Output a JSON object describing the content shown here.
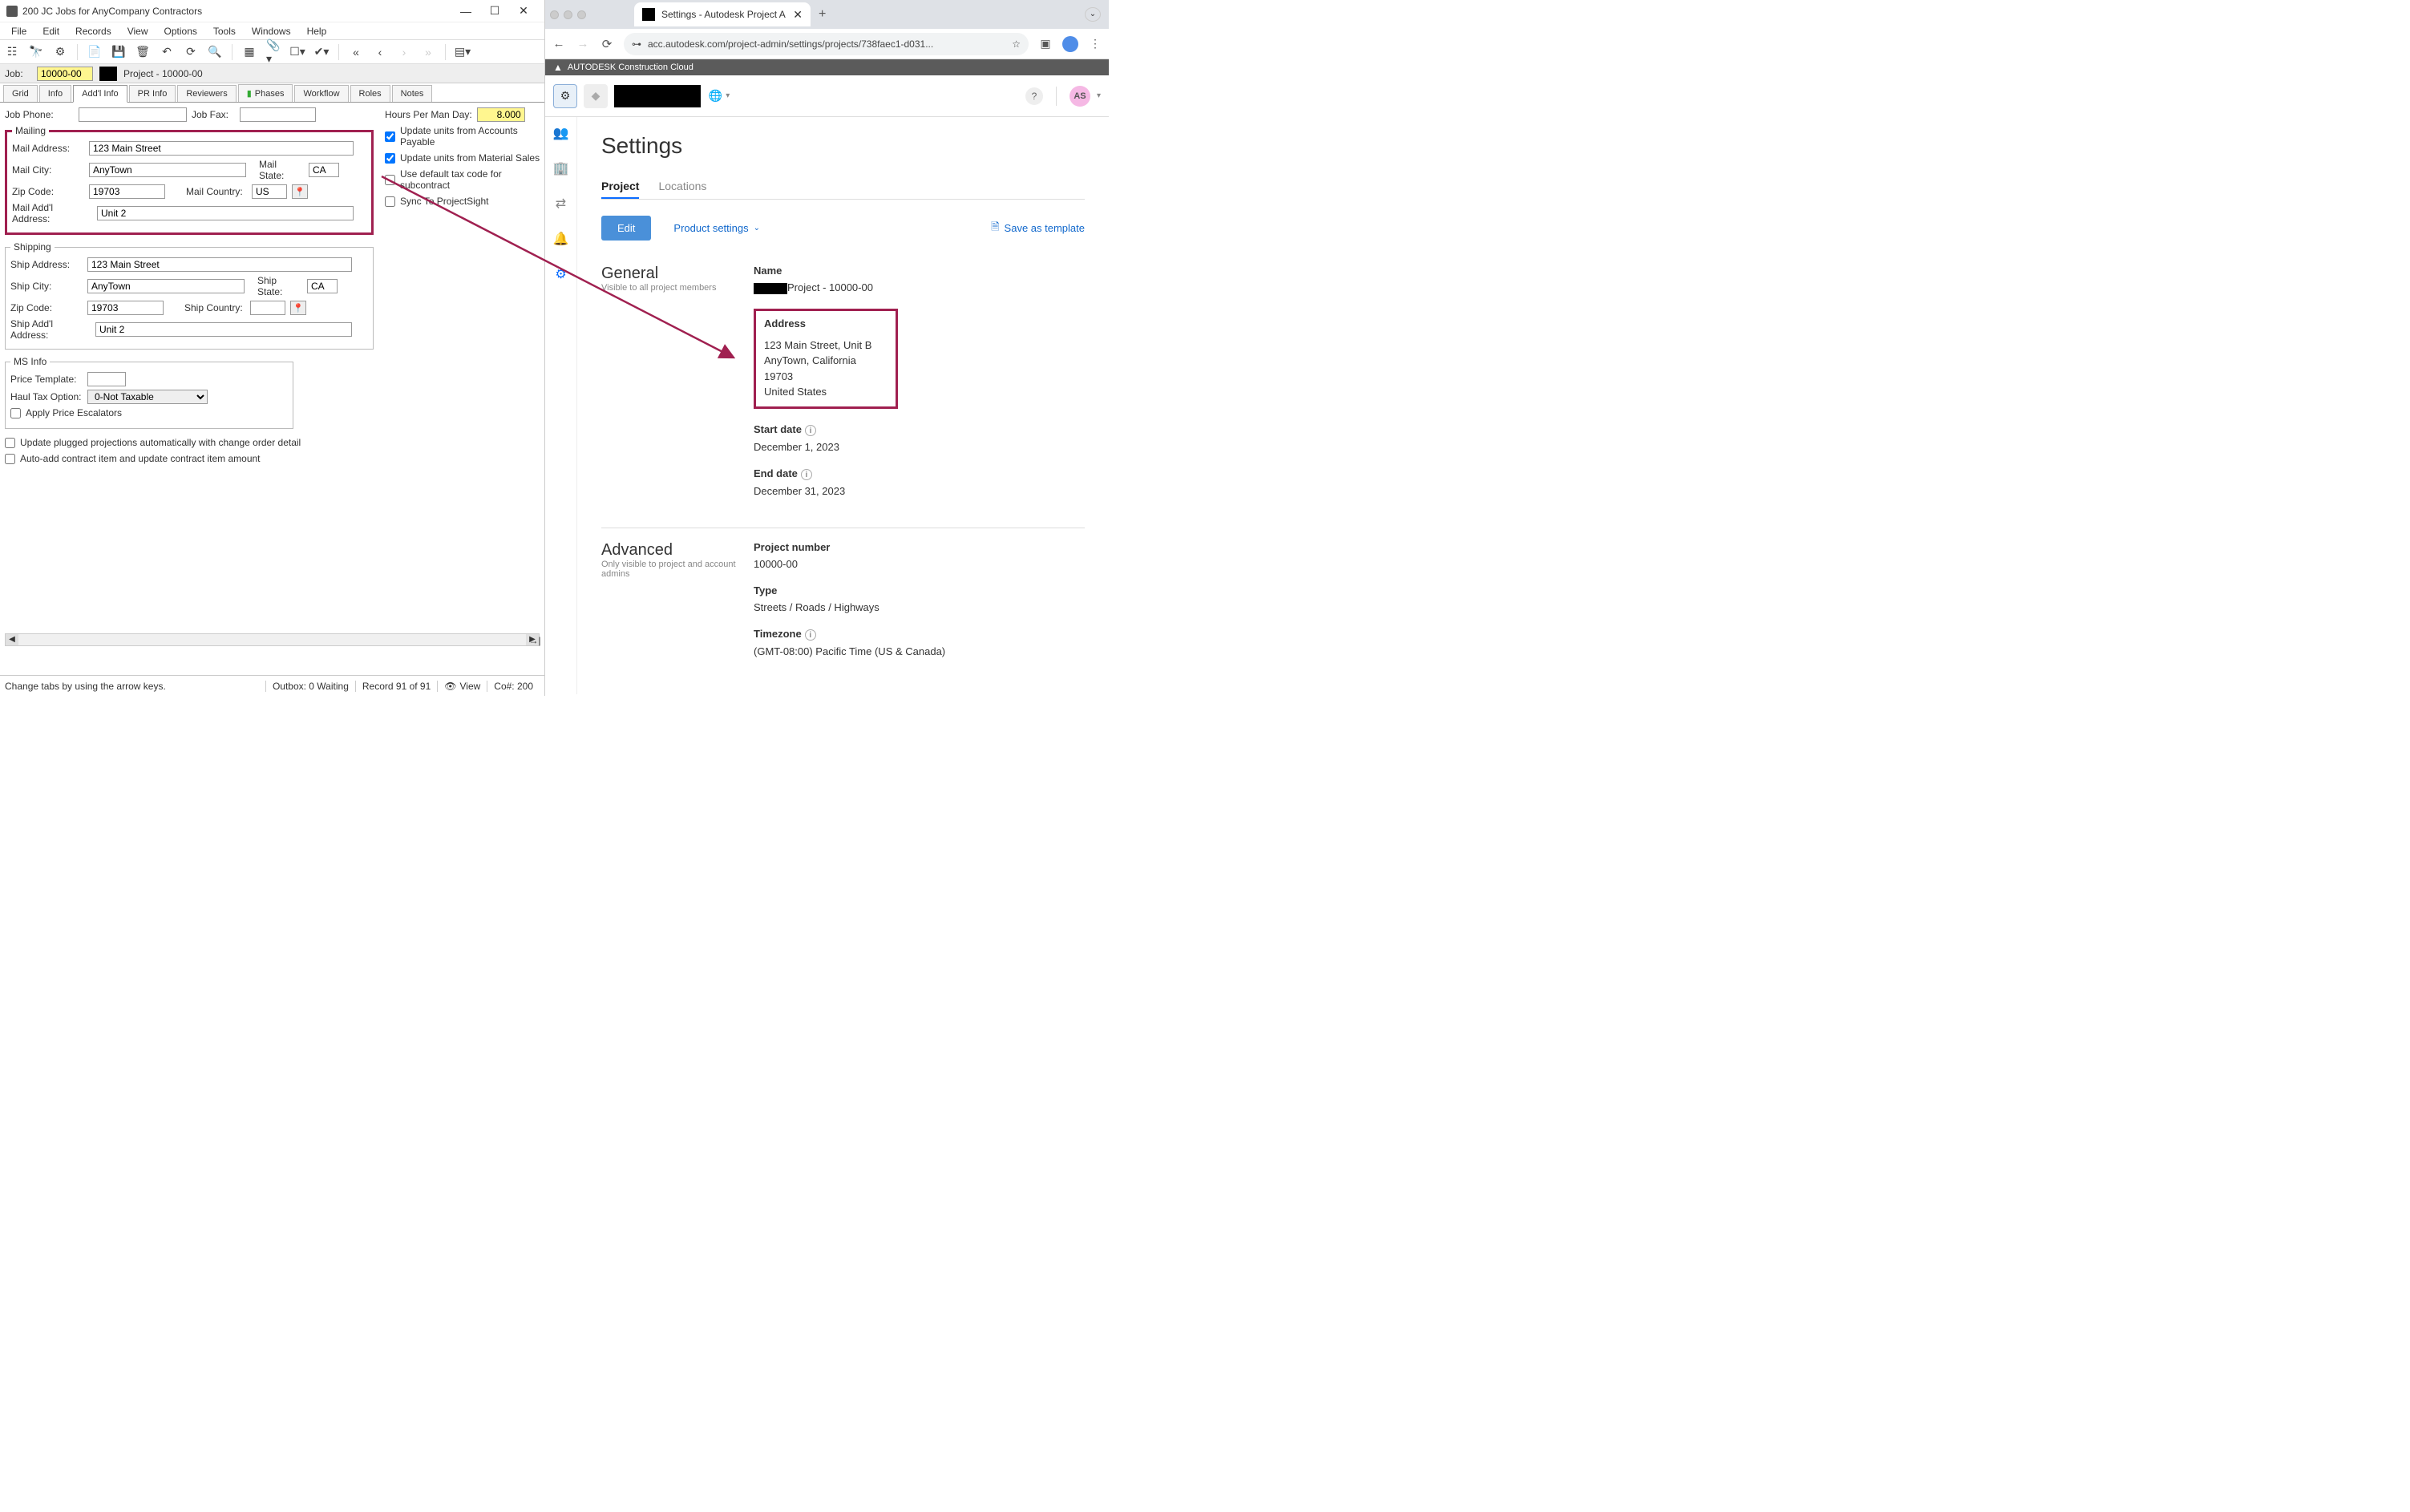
{
  "leftWindow": {
    "title": "200 JC Jobs for AnyCompany Contractors",
    "menus": [
      "File",
      "Edit",
      "Records",
      "View",
      "Options",
      "Tools",
      "Windows",
      "Help"
    ],
    "job": {
      "label": "Job:",
      "value": "10000-00",
      "name": "Project - 10000-00"
    },
    "tabs": [
      "Grid",
      "Info",
      "Add'l Info",
      "PR Info",
      "Reviewers",
      "Phases",
      "Workflow",
      "Roles",
      "Notes"
    ],
    "activeTab": "Add'l Info",
    "jobPhone": {
      "label": "Job Phone:",
      "value": ""
    },
    "jobFax": {
      "label": "Job Fax:",
      "value": ""
    },
    "hoursPerManDay": {
      "label": "Hours Per Man Day:",
      "value": "8.000"
    },
    "checks": {
      "updateAP": {
        "label": "Update units from Accounts Payable",
        "checked": true
      },
      "updateMS": {
        "label": "Update units from Material Sales",
        "checked": true
      },
      "useDefaultTax": {
        "label": "Use default tax code for subcontract",
        "checked": false
      },
      "syncProjectSight": {
        "label": "Sync To ProjectSight",
        "checked": false
      }
    },
    "mailing": {
      "legend": "Mailing",
      "addressLabel": "Mail Address:",
      "address": "123 Main Street",
      "cityLabel": "Mail City:",
      "city": "AnyTown",
      "stateLabel": "Mail State:",
      "state": "CA",
      "zipLabel": "Zip Code:",
      "zip": "19703",
      "countryLabel": "Mail Country:",
      "country": "US",
      "addlLabel": "Mail Add'l Address:",
      "addl": "Unit 2"
    },
    "shipping": {
      "legend": "Shipping",
      "addressLabel": "Ship Address:",
      "address": "123 Main Street",
      "cityLabel": "Ship City:",
      "city": "AnyTown",
      "stateLabel": "Ship State:",
      "state": "CA",
      "zipLabel": "Zip Code:",
      "zip": "19703",
      "countryLabel": "Ship Country:",
      "country": "",
      "addlLabel": "Ship Add'l Address:",
      "addl": "Unit 2"
    },
    "msInfo": {
      "legend": "MS Info",
      "priceTemplateLabel": "Price Template:",
      "haulTaxLabel": "Haul Tax Option:",
      "haulTaxValue": "0-Not Taxable",
      "applyEscalators": {
        "label": "Apply Price Escalators",
        "checked": false
      }
    },
    "updatePlugged": {
      "label": "Update plugged projections automatically with change order detail",
      "checked": false
    },
    "autoAdd": {
      "label": "Auto-add contract item and update contract item amount",
      "checked": false
    },
    "statusMsg": "Change tabs by using the arrow keys.",
    "statusOutbox": "Outbox: 0 Waiting",
    "statusRecord": "Record 91 of 91",
    "statusView": "View",
    "statusCo": "Co#: 200"
  },
  "browser": {
    "tabTitle": "Settings - Autodesk Project A",
    "url": "acc.autodesk.com/project-admin/settings/projects/738faec1-d031...",
    "brandBar": "AUTODESK Construction Cloud",
    "avatarInitials": "AS"
  },
  "settings": {
    "pageTitle": "Settings",
    "tabs": [
      "Project",
      "Locations"
    ],
    "activeTab": "Project",
    "editLabel": "Edit",
    "productSettingsLabel": "Product settings",
    "saveTemplateLabel": "Save as template",
    "general": {
      "title": "General",
      "subtitle": "Visible to all project members",
      "nameLabel": "Name",
      "nameValue": "Project - 10000-00",
      "addressLabel": "Address",
      "addressLine1": "123 Main Street, Unit B",
      "addressLine2": "AnyTown, California 19703",
      "addressLine3": "United States",
      "startDateLabel": "Start date",
      "startDateValue": "December 1, 2023",
      "endDateLabel": "End date",
      "endDateValue": "December 31, 2023"
    },
    "advanced": {
      "title": "Advanced",
      "subtitle": "Only visible to project and account admins",
      "projectNumberLabel": "Project number",
      "projectNumberValue": "10000-00",
      "typeLabel": "Type",
      "typeValue": "Streets / Roads / Highways",
      "timezoneLabel": "Timezone",
      "timezoneValue": "(GMT-08:00) Pacific Time (US & Canada)"
    }
  }
}
